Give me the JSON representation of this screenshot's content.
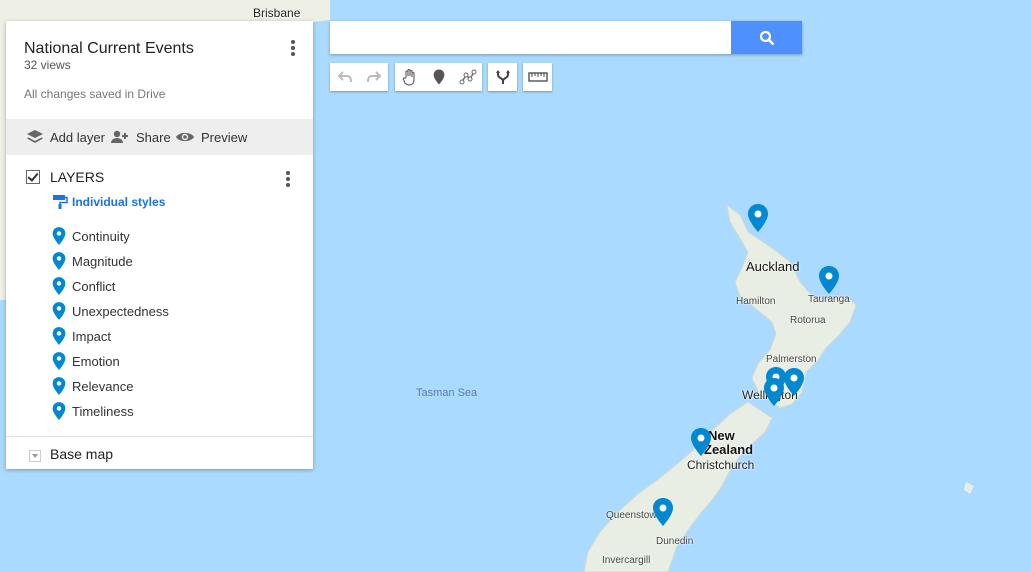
{
  "panel": {
    "title": "National Current Events",
    "views": "32 views",
    "saved": "All changes saved in Drive",
    "toolbar": {
      "add_layer": "Add layer",
      "share": "Share",
      "preview": "Preview"
    },
    "layer_title": "LAYERS",
    "styles_label": "Individual styles",
    "items": [
      "Continuity",
      "Magnitude",
      "Conflict",
      "Unexpectedness",
      "Impact",
      "Emotion",
      "Relevance",
      "Timeliness"
    ],
    "base_map": "Base map"
  },
  "search": {
    "value": "",
    "placeholder": ""
  },
  "map": {
    "labels": {
      "brisbane": "Brisbane",
      "auckland": "Auckland",
      "hamilton": "Hamilton",
      "tauranga": "Tauranga",
      "rotorua": "Rotorua",
      "palmerston": "Palmerston",
      "wellington": "Wellington",
      "new": "New",
      "zealand": "Zealand",
      "christchurch": "Christchurch",
      "queenstown": "Queenstown",
      "dunedin": "Dunedin",
      "invercargill": "Invercargill",
      "tasman": "Tasman Sea"
    },
    "colors": {
      "sea": "#aadaff",
      "land": "#e8eee3",
      "pin": "#0288d1"
    }
  }
}
